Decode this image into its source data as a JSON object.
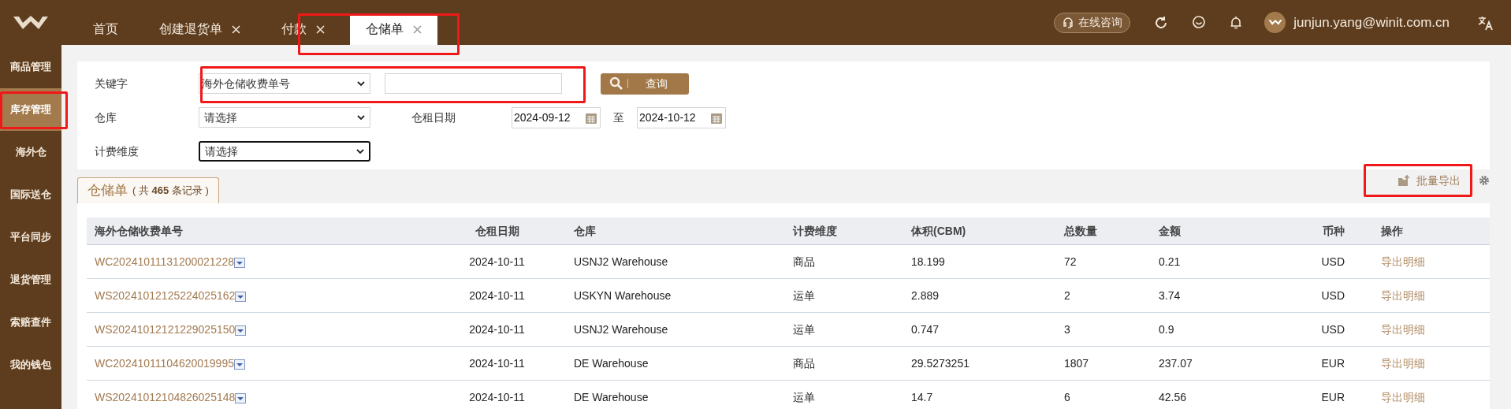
{
  "header": {
    "consult": "在线咨询",
    "user": "junjun.yang@winit.com.cn"
  },
  "tabs": [
    {
      "label": "首页",
      "closable": false,
      "selected": false
    },
    {
      "label": "创建退货单",
      "closable": true,
      "selected": false
    },
    {
      "label": "付款",
      "closable": true,
      "selected": false
    },
    {
      "label": "仓储单",
      "closable": true,
      "selected": true
    }
  ],
  "sidebar": {
    "items": [
      {
        "label": "商品管理",
        "selected": false
      },
      {
        "label": "库存管理",
        "selected": true
      },
      {
        "label": "海外仓",
        "selected": false
      },
      {
        "label": "国际送仓",
        "selected": false
      },
      {
        "label": "平台同步",
        "selected": false
      },
      {
        "label": "退货管理",
        "selected": false
      },
      {
        "label": "索赔查件",
        "selected": false
      },
      {
        "label": "我的钱包",
        "selected": false
      }
    ]
  },
  "filters": {
    "keyword_label": "关键字",
    "keyword_type": "海外仓储收费单号",
    "search_button": "查询",
    "warehouse_label": "仓库",
    "warehouse_value": "请选择",
    "date_label": "仓租日期",
    "date_from": "2024-09-12",
    "date_separator": "至",
    "date_to": "2024-10-12",
    "billing_label": "计费维度",
    "billing_value": "请选择",
    "billing_focused": true
  },
  "list_tab": {
    "title": "仓储单",
    "count_text": "( 共 **465** 条记录 )"
  },
  "batch_export": "批量导出",
  "table": {
    "columns": [
      "海外仓储收费单号",
      "仓租日期",
      "仓库",
      "计费维度",
      "体积(CBM)",
      "总数量",
      "金额",
      "币种",
      "操作"
    ],
    "rows": [
      [
        "WC20241011131200021228",
        "2024-10-11",
        "USNJ2 Warehouse",
        "商品",
        "18.199",
        "72",
        "0.21",
        "USD",
        "导出明细"
      ],
      [
        "WS20241012125224025162",
        "2024-10-11",
        "USKYN Warehouse",
        "运单",
        "2.889",
        "2",
        "3.74",
        "USD",
        "导出明细"
      ],
      [
        "WS20241012121229025150",
        "2024-10-11",
        "USNJ2 Warehouse",
        "运单",
        "0.747",
        "3",
        "0.9",
        "USD",
        "导出明细"
      ],
      [
        "WC20241011104620019995",
        "2024-10-11",
        "DE Warehouse",
        "商品",
        "29.5273251",
        "1807",
        "237.07",
        "EUR",
        "导出明细"
      ],
      [
        "WS20241012104826025148",
        "2024-10-11",
        "DE Warehouse",
        "运单",
        "14.7",
        "6",
        "42.56",
        "EUR",
        "导出明细"
      ]
    ]
  }
}
